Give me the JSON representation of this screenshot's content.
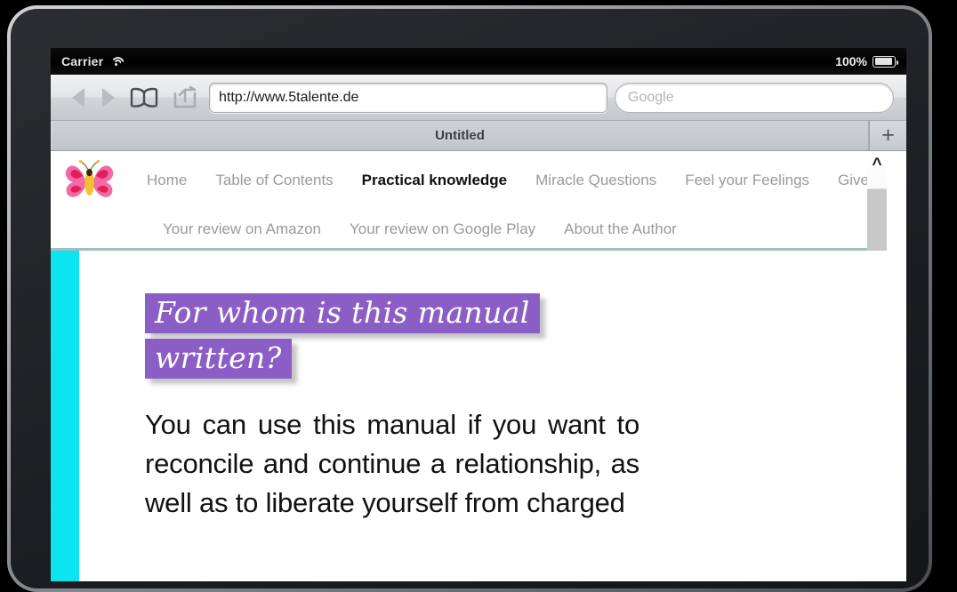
{
  "status_bar": {
    "carrier": "Carrier",
    "wifi_icon": "wifi-icon",
    "battery_percent": "100%",
    "battery_icon": "battery-full-icon"
  },
  "toolbar": {
    "back_icon": "back-arrow-icon",
    "forward_icon": "forward-arrow-icon",
    "bookmarks_icon": "book-icon",
    "share_icon": "share-arrow-icon",
    "url_value": "http://www.5talente.de",
    "search_placeholder": "Google",
    "search_value": ""
  },
  "tab_bar": {
    "tab_title": "Untitled",
    "new_tab_label": "+"
  },
  "site_nav": {
    "logo_icon": "butterfly-logo-icon",
    "row1": [
      {
        "label": "Home",
        "active": false
      },
      {
        "label": "Table of Contents",
        "active": false
      },
      {
        "label": "Practical knowledge",
        "active": true
      },
      {
        "label": "Miracle Questions",
        "active": false
      },
      {
        "label": "Feel your Feelings",
        "active": false
      },
      {
        "label": "Give Permissi",
        "active": false
      }
    ],
    "row2": [
      {
        "label": "Your review on Amazon",
        "active": false
      },
      {
        "label": "Your review on Google Play",
        "active": false
      },
      {
        "label": "About the Author",
        "active": false
      }
    ],
    "scroll_up_icon": "chevron-up-icon"
  },
  "article": {
    "heading_line1": "For whom is this manual",
    "heading_line2": "written?",
    "body": "You can use this manual if you want to reconcile and continue a relationship, as well as to liberate yourself from charged"
  },
  "colors": {
    "heading_highlight": "#8b5ec6",
    "accent_strip": "#0ce4f0",
    "nav_active_text": "#111111",
    "nav_text": "#9a9a9a",
    "nav_border": "#9fc0bf"
  }
}
